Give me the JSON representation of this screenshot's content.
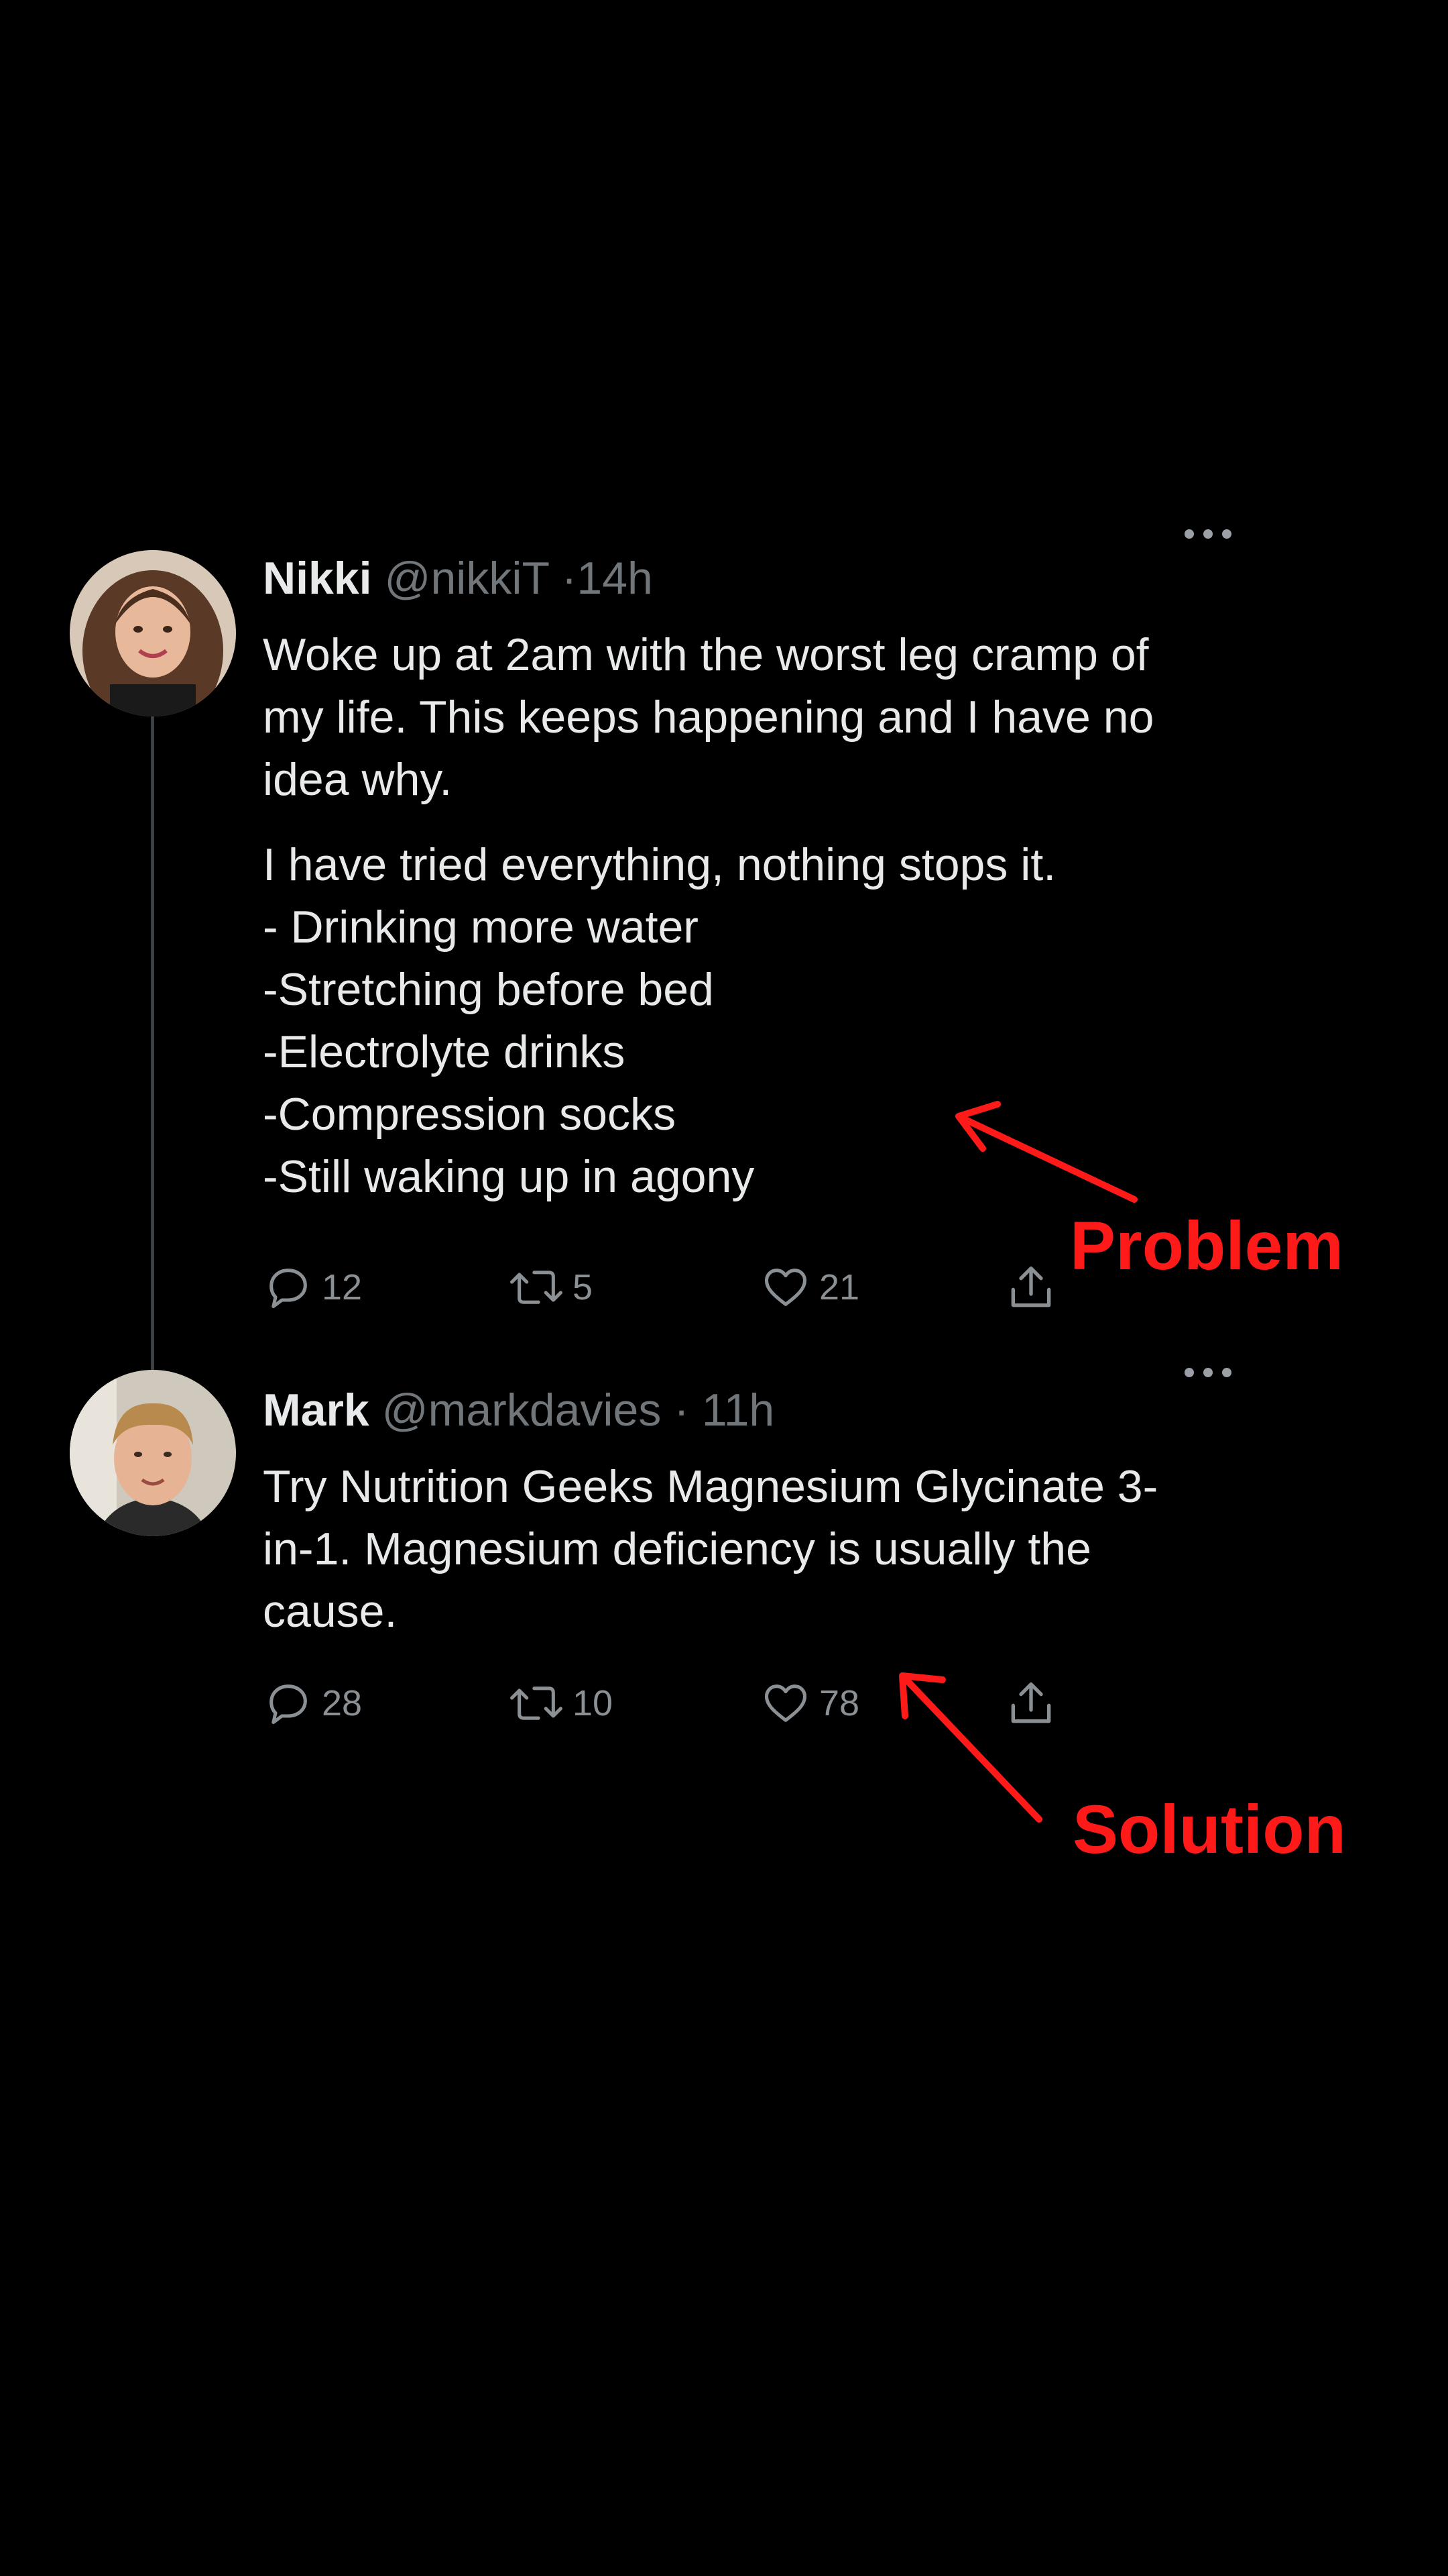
{
  "thread": {
    "tweets": [
      {
        "name": "Nikki",
        "handle": "@nikkiT",
        "separator": "·",
        "time": "14h",
        "paragraphs": [
          "Woke up at 2am with the worst leg cramp of my life. This keeps happening and I have no idea why.",
          "I have tried everything, nothing stops it."
        ],
        "list_lines": [
          "- Drinking more water",
          "-Stretching before bed",
          "-Electrolyte drinks",
          "-Compression socks",
          "-Still waking up in agony"
        ],
        "actions": {
          "replies": "12",
          "retweets": "5",
          "likes": "21"
        }
      },
      {
        "name": "Mark",
        "handle": "@markdavies",
        "separator": "·",
        "time": "11h",
        "paragraphs": [
          "Try Nutrition Geeks Magnesium Glycinate 3-in-1. Magnesium deficiency is usually the cause."
        ],
        "actions": {
          "replies": "28",
          "retweets": "10",
          "likes": "78"
        }
      }
    ]
  },
  "annotations": {
    "problem_label": "Problem",
    "solution_label": "Solution",
    "color": "#ff1a1a"
  },
  "icons": {
    "reply": "reply-icon",
    "retweet": "retweet-icon",
    "like": "heart-icon",
    "share": "share-icon",
    "more": "more-options-icon"
  },
  "colors": {
    "background": "#000000",
    "primary_text": "#e7e9ea",
    "secondary_text": "#71767b",
    "annotation": "#ff1a1a"
  }
}
